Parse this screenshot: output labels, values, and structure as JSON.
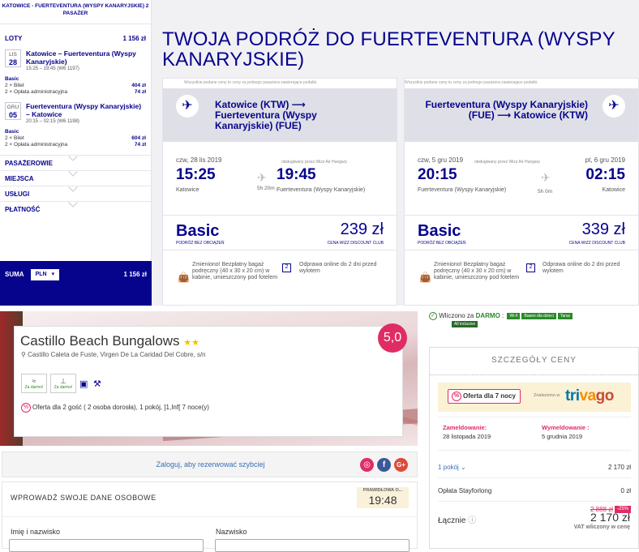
{
  "wizz": {
    "sidebar": {
      "header": "KATOWICE - FUERTEVENTURA (WYSPY KANARYJSKIE) 2 PASAŻER",
      "flights_label": "LOTY",
      "flights_total": "1 156 zł",
      "outbound": {
        "month": "LIS",
        "day": "28",
        "title": "Katowice – Fuerteventura (Wyspy Kanaryjskie)",
        "sub": "15:25 – 19:45 (W6 1197)",
        "fare": "Basic",
        "ticket_label": "2 × Bilet",
        "ticket_price": "404 zł",
        "fee_label": "2 × Opłata administracyjna",
        "fee_price": "74 zł"
      },
      "inbound": {
        "month": "GRU",
        "day": "05",
        "title": "Fuerteventura (Wyspy Kanaryjskie) – Katowice",
        "sub": "20:15 – 02:15 (W6 1198)",
        "fare": "Basic",
        "ticket_label": "2 × Bilet",
        "ticket_price": "604 zł",
        "fee_label": "2 × Opłata administracyjna",
        "fee_price": "74 zł"
      },
      "sections": [
        "PASAŻEROWIE",
        "MIEJSCA",
        "USŁUGI",
        "PŁATNOŚĆ"
      ],
      "sum_label": "SUMA",
      "currency": "PLN",
      "sum_total": "1 156 zł"
    },
    "title": "TWOJA PODRÓŻ DO FUERTEVENTURA (WYSPY KANARYJSKIE)",
    "note": "Wszystkie podane ceny to ceny za jednego pasażera zawierające podatki.",
    "out_card": {
      "route": "Katowice (KTW) ⟶ Fuerteventura (Wyspy Kanaryjskie) (FUE)",
      "date": "czw, 28 lis 2019",
      "operator": "obsługiwany przez Wizz Air Hungary",
      "dep_time": "15:25",
      "arr_time": "19:45",
      "duration": "5h 20m",
      "from": "Katowice",
      "to": "Fuerteventura (Wyspy Kanaryjskie)",
      "fare": "Basic",
      "fare_sub": "PODRÓŻ BEZ OBCIĄŻEŃ",
      "price": "239 zł",
      "price_sub": "CENA WIZZ DISCOUNT CLUB",
      "bag": "Zmieniono! Bezpłatny bagaż podręczny (40 x 30 x 20 cm) w kabinie, umieszczony pod fotelem",
      "checkin": "Odprawa online do 2 dni przed wylotem"
    },
    "ret_card": {
      "route": "Fuerteventura (Wyspy Kanaryjskie) (FUE) ⟶ Katowice (KTW)",
      "date": "czw, 5 gru 2019",
      "operator": "obsługiwany przez Wizz Air Hungary",
      "arr_date": "pt, 6 gru 2019",
      "dep_time": "20:15",
      "arr_time": "02:15",
      "duration": "5h 0m",
      "from": "Fuerteventura (Wyspy Kanaryjskie)",
      "to": "Katowice",
      "fare": "Basic",
      "fare_sub": "PODRÓŻ BEZ OBCIĄŻEŃ",
      "price": "339 zł",
      "price_sub": "CENA WIZZ DISCOUNT CLUB",
      "bag": "Zmieniono! Bezpłatny bagaż podręczny (40 x 30 x 20 cm) w kabinie, umieszczony pod fotelem",
      "checkin": "Odprawa online do 2 dni przed wylotem"
    }
  },
  "hotel": {
    "name": "Castillo Beach Bungalows",
    "stars": "★★",
    "address": "Castillo Caleta de Fuste, Virgen De La Caridad Del Cobre, s/n",
    "score": "5,0",
    "amenities": [
      {
        "icon": "wifi-icon",
        "label": "Za darmo!"
      },
      {
        "icon": "parking-icon",
        "label": "Za darmo!"
      }
    ],
    "offer": "Oferta dla 2 gość ( 2 osoba dorosła), 1 pokój, ]1,Inf[ 7 noce(y)",
    "login": "Zaloguj, aby rezerwować szybciej",
    "form_title": "WPROWADŹ SWOJE DANE OSOBOWE",
    "timer_label": "PRAWIDŁOWA O...",
    "timer": "19:48",
    "name_label": "Imię i nazwisko",
    "surname_label": "Nazwisko",
    "included_prefix": "Wliczono za",
    "included_free": "DARMO",
    "included_tags": [
      "Wi-fi",
      "Basen dla dzieci",
      "Taras",
      "All inclusive"
    ],
    "price": {
      "title": "SZCZEGÓŁY CENY",
      "promo": "Oferta dla 7 nocy",
      "found_in": "Znaleziono w",
      "brand": "trivago",
      "checkin_label": "Zameldowanie:",
      "checkin": "28 listopada 2019",
      "checkout_label": "Wymeldowanie :",
      "checkout": "5 grudnia 2019",
      "rooms": "1 pokój",
      "rooms_price": "2 170 zł",
      "fee_label": "Opłata Stayforlong",
      "fee": "0 zł",
      "old_price": "2 888 zł",
      "discount": "-25%",
      "total_label": "Łącznie",
      "total": "2 170 zł",
      "vat": "VAT wliczony w cenę"
    }
  }
}
